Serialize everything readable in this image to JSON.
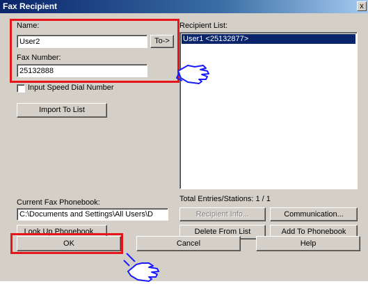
{
  "window": {
    "title": "Fax Recipient",
    "close_glyph": "x"
  },
  "name": {
    "label": "Name:",
    "value": "User2"
  },
  "to_button": {
    "label": "To->"
  },
  "fax_number": {
    "label": "Fax Number:",
    "value": "25132888"
  },
  "speed_dial": {
    "label": "Input Speed Dial Number",
    "checked": false
  },
  "import_button": {
    "label": "Import To List"
  },
  "recipient_list": {
    "label": "Recipient List:",
    "items": [
      {
        "text": "User1 <25132877>",
        "selected": true
      }
    ]
  },
  "phonebook": {
    "label": "Current Fax Phonebook:",
    "path": "C:\\Documents and Settings\\All Users\\D",
    "lookup_button": "Look Up Phonebook..."
  },
  "totals": {
    "text": "Total Entries/Stations: 1 / 1"
  },
  "buttons": {
    "recipient_info": "Recipient Info...",
    "communication": "Communication...",
    "delete": "Delete From List",
    "add_phonebook": "Add To Phonebook",
    "ok": "OK",
    "cancel": "Cancel",
    "help": "Help"
  },
  "colors": {
    "highlight": "#e8141c",
    "selection": "#0a246a",
    "face": "#d4d0c8"
  },
  "icons": {
    "pointer": "pointing-hand-icon"
  }
}
